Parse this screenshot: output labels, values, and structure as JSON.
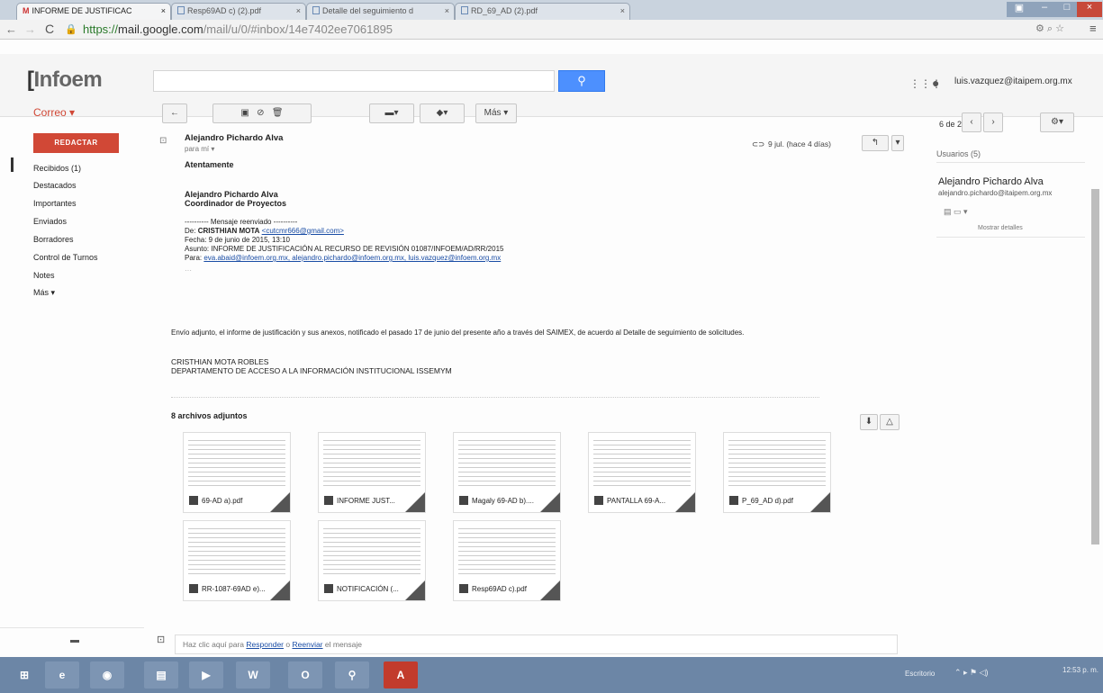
{
  "browser": {
    "tabs": [
      {
        "label": "INFORME DE JUSTIFICAC"
      },
      {
        "label": "Resp69AD c) (2).pdf"
      },
      {
        "label": "Detalle del seguimiento d"
      },
      {
        "label": "RD_69_AD (2).pdf"
      }
    ],
    "url_scheme": "https://",
    "url_host": "mail.google.com",
    "url_path": "/mail/u/0/#inbox/14e7402ee7061895"
  },
  "gmail": {
    "logo_brand": "Infoem",
    "account": "luis.vazquez@itaipem.org.mx",
    "correo_label": "Correo ▾",
    "compose_label": "REDACTAR",
    "nav": [
      "Recibidos (1)",
      "Destacados",
      "Importantes",
      "Enviados",
      "Borradores",
      "Control de Turnos",
      "Notes",
      "Más ▾"
    ],
    "toolbar": {
      "more": "Más ▾",
      "pager": "6 de 241"
    },
    "message": {
      "sender": "Alejandro Pichardo Alva",
      "to": "para mí",
      "date": "9 jul. (hace 4 días)",
      "body_greeting": "Atentamente",
      "sig_name": "Alejandro Pichardo Alva",
      "sig_title": "Coordinador de Proyectos",
      "fwd_header": "---------- Mensaje reenviado ----------",
      "fwd_from_label": "De:",
      "fwd_from_name": "CRISTHIAN MOTA",
      "fwd_from_email": "<cutcmr666@gmail.com>",
      "fwd_date": "Fecha: 9 de junio de 2015, 13:10",
      "fwd_subject": "Asunto: INFORME DE JUSTIFICACIÓN AL RECURSO DE REVISIÓN 01087/INFOEM/AD/RR/2015",
      "fwd_to_label": "Para:",
      "fwd_to_list": "eva.abaid@infoem.org.mx, alejandro.pichardo@infoem.org.mx, luis.vazquez@infoem.org.mx",
      "body_main": "Envío adjunto, el informe de justificación y sus anexos, notificado el pasado 17 de junio del presente año a través del SAIMEX, de acuerdo al Detalle de seguimiento de solicitudes.",
      "sender2_name": "CRISTHIAN MOTA ROBLES",
      "sender2_dept": "DEPARTAMENTO DE ACCESO A LA INFORMACIÓN INSTITUCIONAL ISSEMYM",
      "attach_heading": "8 archivos adjuntos",
      "attachments": [
        "69-AD a).pdf",
        "INFORME JUST...",
        "Magaly 69-AD b)....",
        "PANTALLA 69-A...",
        "P_69_AD d).pdf",
        "RR-1087-69AD e)...",
        "NOTIFICACIÓN (...",
        "Resp69AD c).pdf"
      ],
      "reply_prompt_pre": "Haz clic aquí para",
      "reply_link": "Responder",
      "reply_mid": "o",
      "forward_link": "Reenviar",
      "reply_prompt_post": "el mensaje"
    },
    "right_panel": {
      "users_label": "Usuarios (5)",
      "contact_name": "Alejandro Pichardo Alva",
      "contact_email": "alejandro.pichardo@itaipem.org.mx",
      "details": "Mostrar detalles"
    }
  },
  "taskbar": {
    "time": "12:53 p. m.",
    "lang": "Escritorio"
  }
}
